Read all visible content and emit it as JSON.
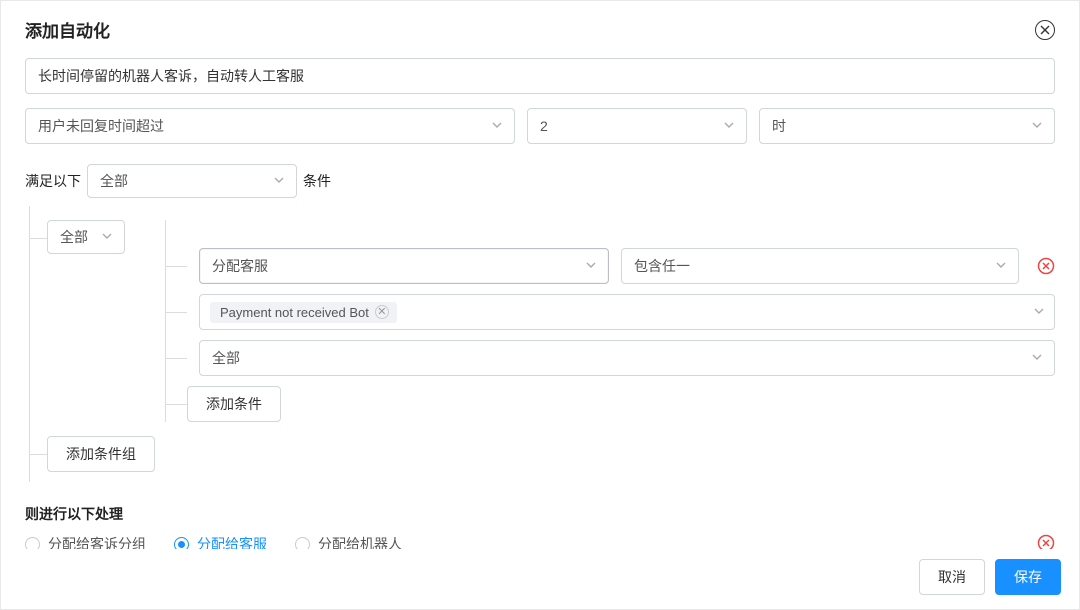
{
  "modal": {
    "title": "添加自动化",
    "name_input": "长时间停留的机器人客诉，自动转人工客服"
  },
  "trigger": {
    "type": "用户未回复时间超过",
    "value": "2",
    "unit": "时"
  },
  "conditions": {
    "prefix": "满足以下",
    "match_mode": "全部",
    "suffix": "条件",
    "group": {
      "mode": "全部",
      "items": [
        {
          "field": "分配客服",
          "operator": "包含任一"
        }
      ],
      "tags": [
        "Payment not received Bot"
      ],
      "sub_mode": "全部",
      "add_condition_label": "添加条件"
    },
    "add_group_label": "添加条件组"
  },
  "actions": {
    "title": "则进行以下处理",
    "options": [
      {
        "label": "分配给客诉分组",
        "selected": false
      },
      {
        "label": "分配给客服",
        "selected": true
      },
      {
        "label": "分配给机器人",
        "selected": false
      }
    ]
  },
  "footer": {
    "cancel": "取消",
    "save": "保存"
  }
}
